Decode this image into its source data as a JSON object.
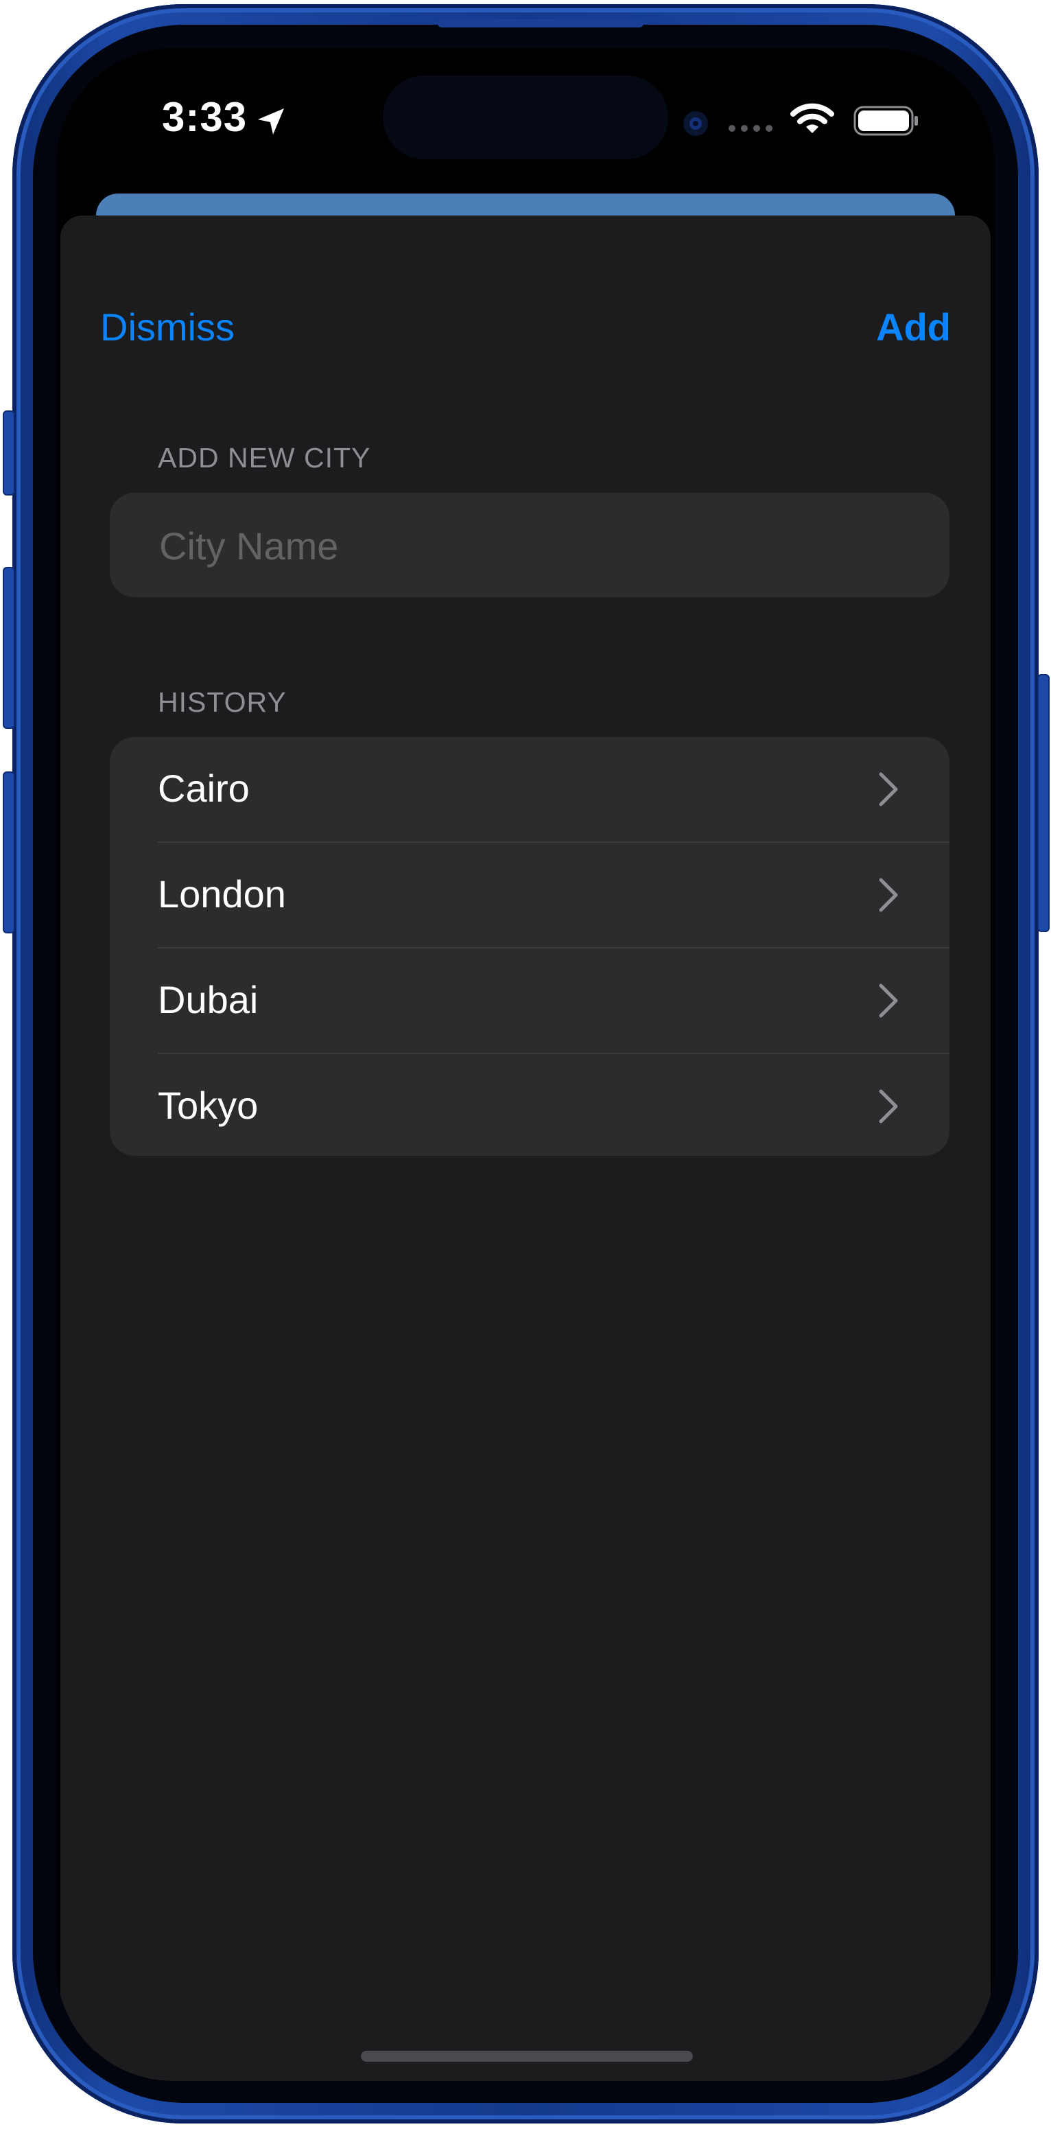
{
  "status_bar": {
    "time": "3:33",
    "location_icon": "location-arrow-icon",
    "wifi_icon": "wifi-icon",
    "battery_icon": "battery-full-icon"
  },
  "nav": {
    "dismiss_label": "Dismiss",
    "add_label": "Add",
    "accent_color": "#0a84ff"
  },
  "add_section": {
    "header": "ADD NEW CITY",
    "input": {
      "value": "",
      "placeholder": "City Name"
    }
  },
  "history_section": {
    "header": "HISTORY",
    "items": [
      {
        "label": "Cairo"
      },
      {
        "label": "London"
      },
      {
        "label": "Dubai"
      },
      {
        "label": "Tokyo"
      }
    ],
    "chevron_icon": "chevron-right-icon"
  },
  "theme": {
    "sheet_background": "#1c1c1e",
    "group_background": "#2c2c2e",
    "secondary_text": "#8e8e93",
    "peek_card_color": "#4a7fb8",
    "frame_color": "#1d4aa8"
  }
}
